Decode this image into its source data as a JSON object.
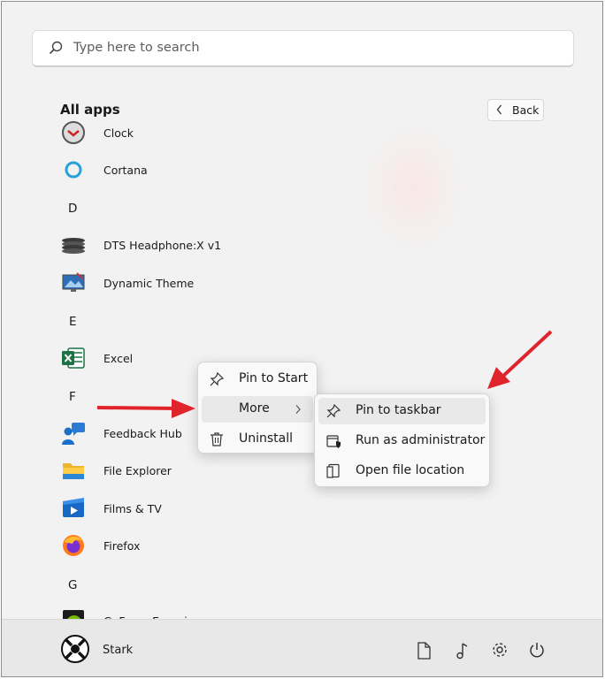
{
  "search": {
    "placeholder": "Type here to search"
  },
  "header": {
    "title": "All apps",
    "back_label": "Back"
  },
  "apps": {
    "clock": "Clock",
    "cortana": "Cortana",
    "letter_d": "D",
    "dts": "DTS Headphone:X v1",
    "dynamic_theme": "Dynamic Theme",
    "letter_e": "E",
    "excel": "Excel",
    "letter_f": "F",
    "feedback_hub": "Feedback Hub",
    "file_explorer": "File Explorer",
    "films_tv": "Films & TV",
    "firefox": "Firefox",
    "letter_g": "G",
    "geforce": "GeForce Experience"
  },
  "context_menu": {
    "pin_to_start": "Pin to Start",
    "more": "More",
    "uninstall": "Uninstall"
  },
  "submenu": {
    "pin_to_taskbar": "Pin to taskbar",
    "run_as_admin": "Run as administrator",
    "open_file_location": "Open file location"
  },
  "user": {
    "name": "Stark"
  },
  "colors": {
    "annotation_arrow": "#e0242b",
    "excel_green": "#1e7145",
    "cortana_blue": "#2aa0d8"
  }
}
